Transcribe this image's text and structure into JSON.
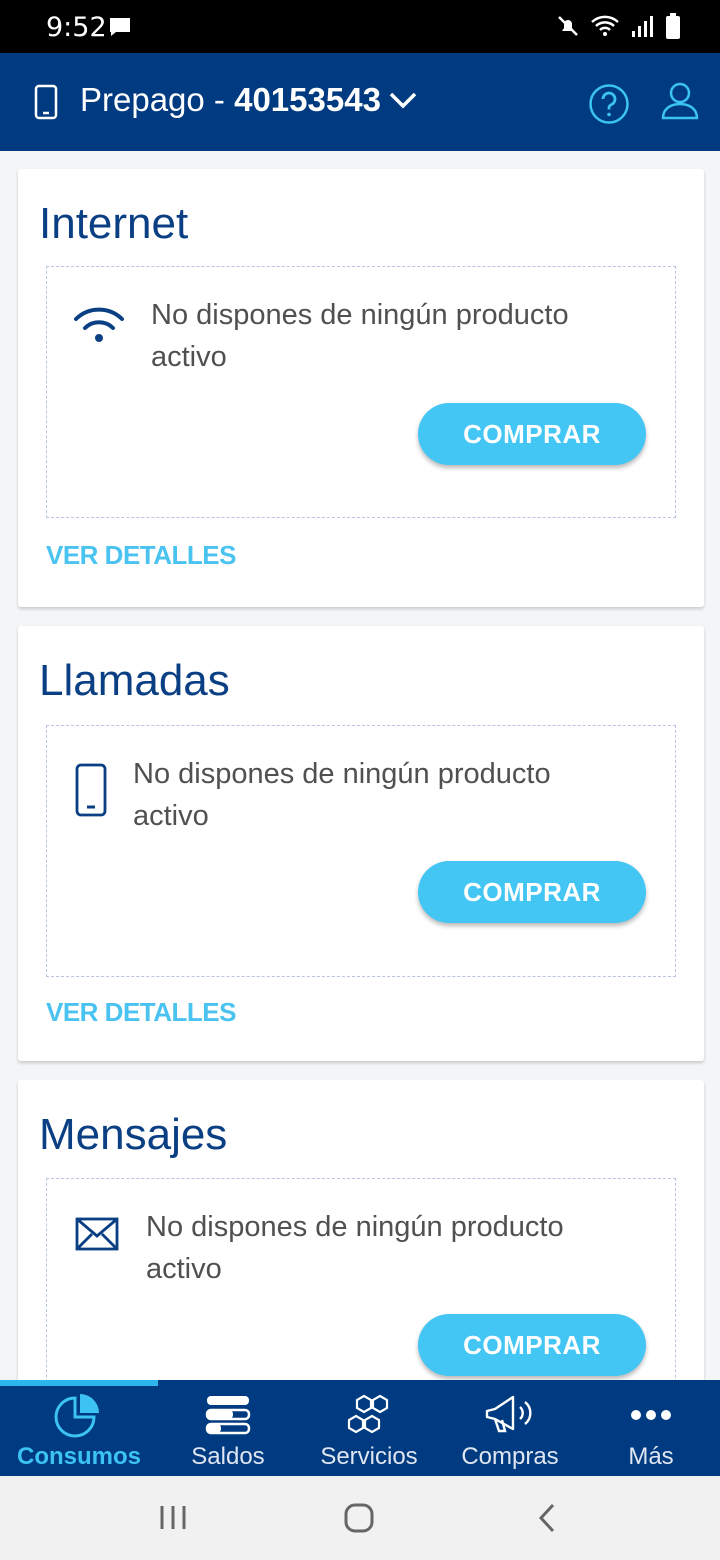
{
  "status_bar": {
    "time": "9:52"
  },
  "header": {
    "plan_type": "Prepago - ",
    "number": "40153543"
  },
  "cards": [
    {
      "title": "Internet",
      "message": "No dispones de ningún producto activo",
      "buy_label": "COMPRAR",
      "details_label": "VER DETALLES",
      "icon": "wifi-icon"
    },
    {
      "title": "Llamadas",
      "message": "No dispones de ningún producto activo",
      "buy_label": "COMPRAR",
      "details_label": "VER DETALLES",
      "icon": "mobile-phone-icon"
    },
    {
      "title": "Mensajes",
      "message": "No dispones de ningún producto activo",
      "buy_label": "COMPRAR",
      "icon": "envelope-icon"
    }
  ],
  "bottom_nav": [
    {
      "label": "Consumos",
      "icon": "pie-chart-icon",
      "active": true
    },
    {
      "label": "Saldos",
      "icon": "balance-bars-icon"
    },
    {
      "label": "Servicios",
      "icon": "hexagons-icon"
    },
    {
      "label": "Compras",
      "icon": "megaphone-icon"
    },
    {
      "label": "Más",
      "icon": "more-dots-icon"
    }
  ],
  "colors": {
    "primary": "#003a80",
    "accent": "#44c6f4",
    "title": "#0b3f84",
    "link": "#4ac3f0"
  }
}
